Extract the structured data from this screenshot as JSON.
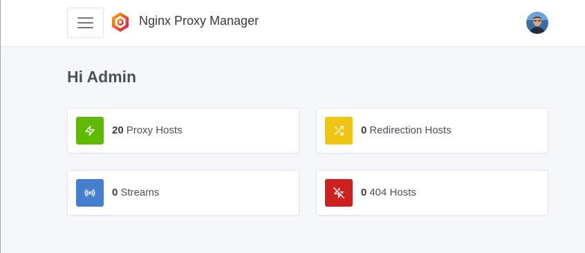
{
  "header": {
    "brand": "Nginx Proxy Manager",
    "menu_icon": "hamburger-menu-icon",
    "logo_icon": "npm-hexagon-logo",
    "avatar_icon": "user-avatar"
  },
  "dashboard": {
    "greeting": "Hi Admin",
    "cards": [
      {
        "count": "20",
        "label": "Proxy Hosts",
        "icon": "bolt-icon",
        "color": "#5eba00"
      },
      {
        "count": "0",
        "label": "Redirection Hosts",
        "icon": "shuffle-icon",
        "color": "#f1c40f"
      },
      {
        "count": "0",
        "label": "Streams",
        "icon": "radio-icon",
        "color": "#467fcf"
      },
      {
        "count": "0",
        "label": "404 Hosts",
        "icon": "zap-off-icon",
        "color": "#cd201f"
      }
    ]
  },
  "colors": {
    "background": "#f5f7fb",
    "header_bg": "#ffffff"
  }
}
